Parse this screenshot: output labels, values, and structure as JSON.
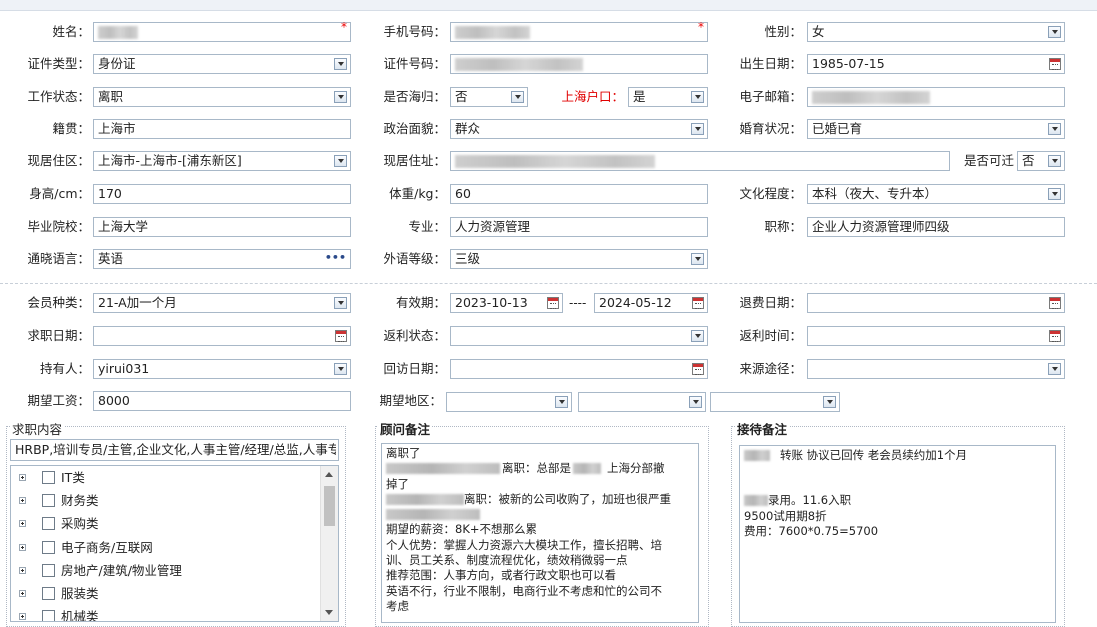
{
  "row1": {
    "name_label": "姓名：",
    "phone_label": "手机号码：",
    "gender_label": "性别：",
    "gender_value": "女",
    "required_mark": "*"
  },
  "row2": {
    "idtype_label": "证件类型：",
    "idtype_value": "身份证",
    "idno_label": "证件号码：",
    "birth_label": "出生日期：",
    "birth_value": "1985-07-15"
  },
  "row3": {
    "workstatus_label": "工作状态：",
    "workstatus_value": "离职",
    "returnee_label": "是否海归：",
    "returnee_value": "否",
    "hukou_label": "上海户口：",
    "hukou_value": "是",
    "email_label": "电子邮箱："
  },
  "row4": {
    "native_label": "籍贯：",
    "native_value": "上海市",
    "political_label": "政治面貌：",
    "political_value": "群众",
    "marital_label": "婚育状况：",
    "marital_value": "已婚已育"
  },
  "row5": {
    "residence_label": "现居住区：",
    "residence_value": "上海市-上海市-[浦东新区]",
    "address_label": "现居住址：",
    "relocate_label": "是否可迁",
    "relocate_value": "否"
  },
  "row6": {
    "height_label": "身高/cm：",
    "height_value": "170",
    "weight_label": "体重/kg：",
    "weight_value": "60",
    "education_label": "文化程度：",
    "education_value": "本科（夜大、专升本）"
  },
  "row7": {
    "school_label": "毕业院校：",
    "school_value": "上海大学",
    "major_label": "专业：",
    "major_value": "人力资源管理",
    "title_label": "职称：",
    "title_value": "企业人力资源管理师四级"
  },
  "row8": {
    "language_label": "通晓语言：",
    "language_value": "英语",
    "language_more": "•••",
    "level_label": "外语等级：",
    "level_value": "三级"
  },
  "row9": {
    "member_label": "会员种类：",
    "member_value": "21-A加一个月",
    "valid_label": "有效期：",
    "valid_from": "2023-10-13",
    "valid_sep": "----",
    "valid_to": "2024-05-12",
    "refund_label": "退费日期："
  },
  "row10": {
    "jobdate_label": "求职日期：",
    "rebate_status_label": "返利状态：",
    "rebate_time_label": "返利时间："
  },
  "row11": {
    "holder_label": "持有人：",
    "holder_value": "yirui031",
    "visit_label": "回访日期：",
    "source_label": "来源途径："
  },
  "row12": {
    "salary_label": "期望工资：",
    "salary_value": "8000",
    "area_label": "期望地区："
  },
  "job": {
    "title": "求职内容",
    "summary": "HRBP,培训专员/主管,企业文化,人事主管/经理/总监,人事专员",
    "items": [
      "IT类",
      "财务类",
      "采购类",
      "电子商务/互联网",
      "房地产/建筑/物业管理",
      "服装类",
      "机械类"
    ]
  },
  "advisor": {
    "title": "顾问备注",
    "line1": "离职了",
    "line2a": "离职：总部是",
    "line2b": "上海分部撤",
    "line3": "掉了",
    "line4": "离职：被新的公司收购了，加班也很严重",
    "line6": "期望的薪资：8K+不想那么累",
    "line7": "个人优势：掌握人力资源六大模块工作，擅长招聘、培",
    "line8": "训、员工关系、制度流程优化，绩效稍微弱一点",
    "line9": "推荐范围：人事方向，或者行政文职也可以看",
    "line10": "英语不行，行业不限制，电商行业不考虑和忙的公司不",
    "line11": "考虑"
  },
  "reception": {
    "title": "接待备注",
    "line1": "转账 协议已回传  老会员续约加1个月",
    "line2": "录用。11.6入职",
    "line3": "9500试用期8折",
    "line4": "费用：7600*0.75=5700"
  },
  "icons": {
    "dropdown": "chevron-down-icon",
    "calendar": "calendar-icon",
    "expand": "plus-icon"
  }
}
